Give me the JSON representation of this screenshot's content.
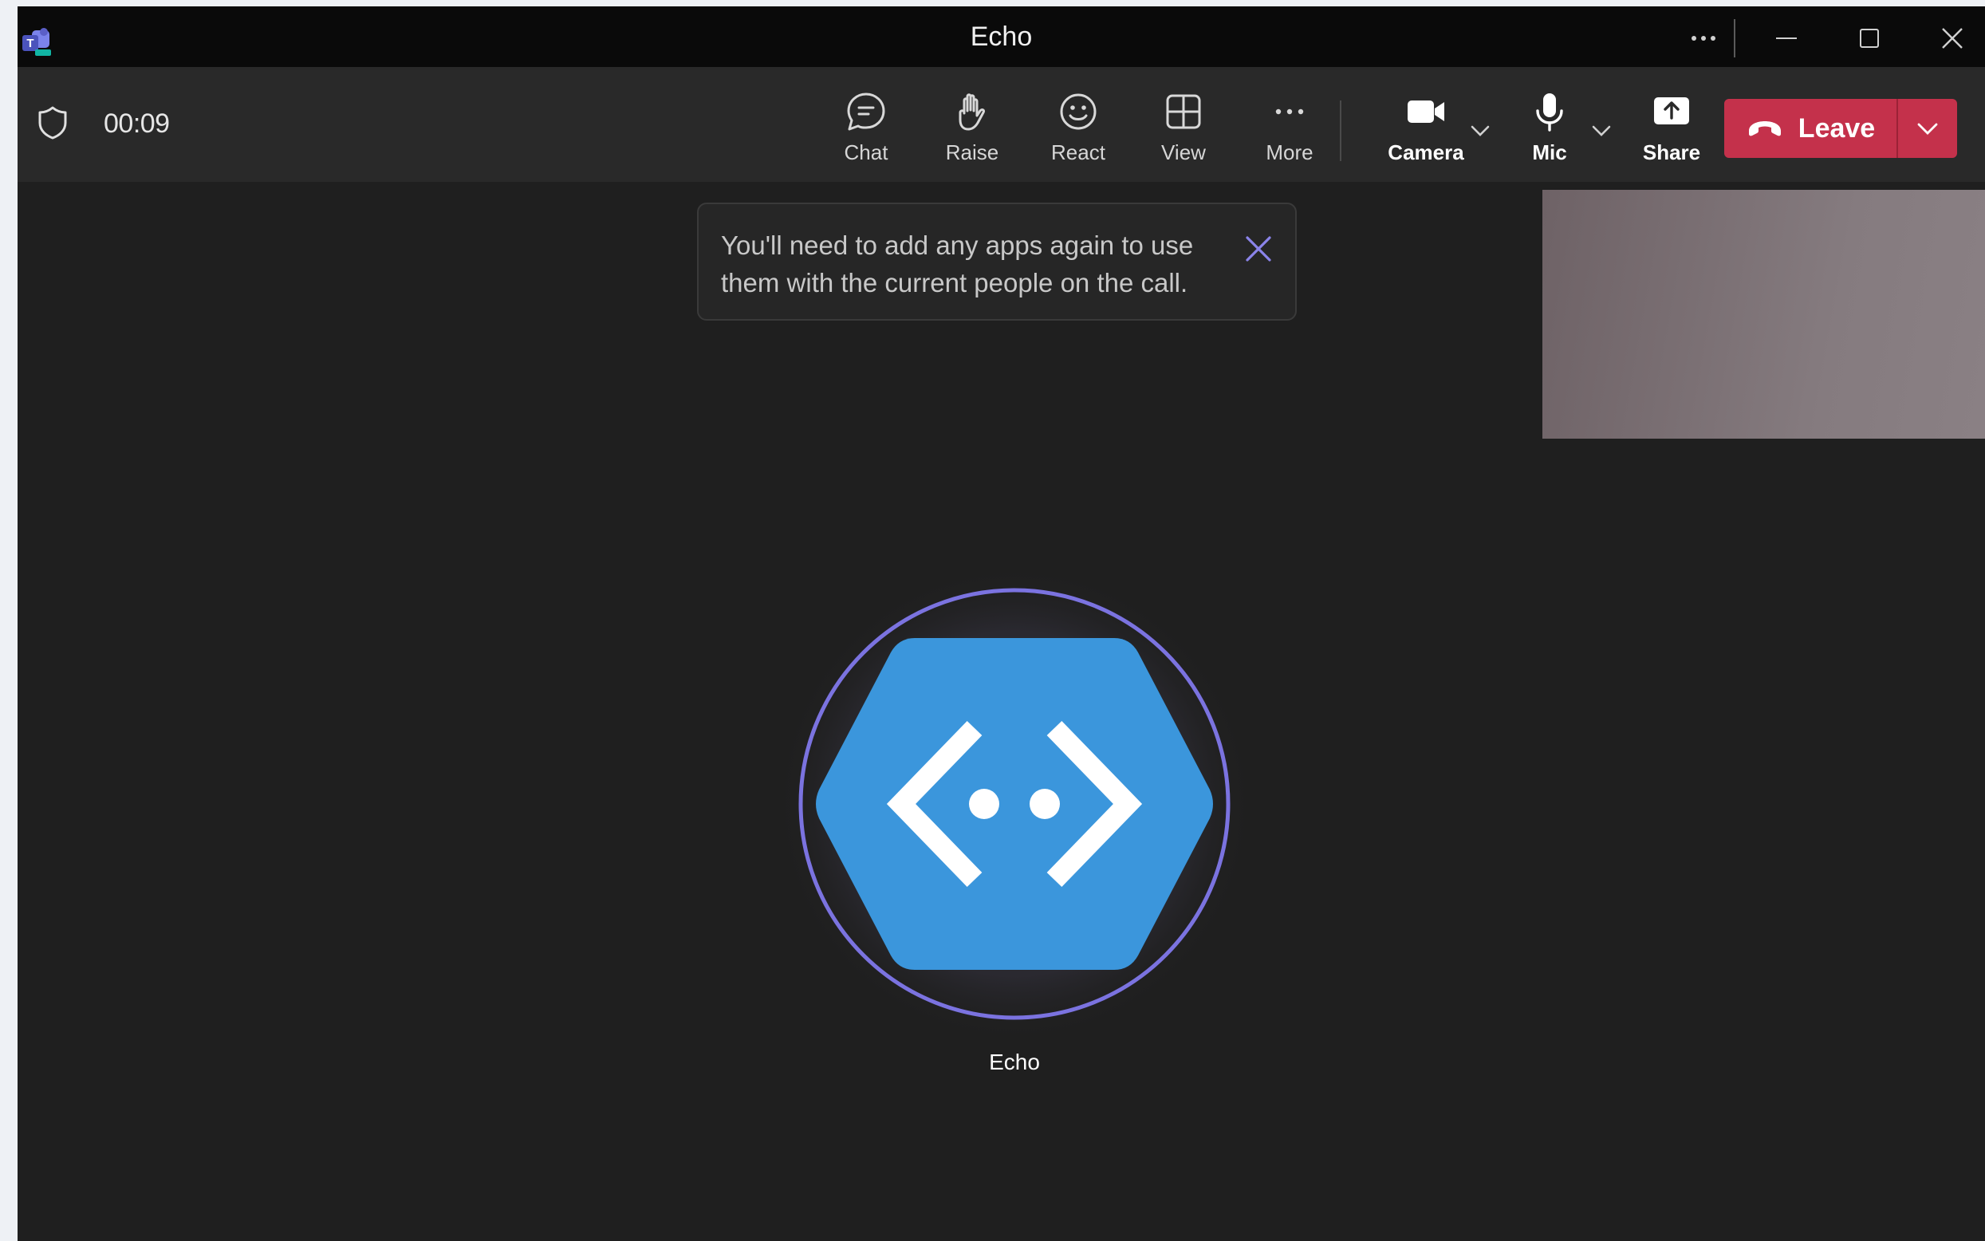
{
  "window": {
    "title": "Echo"
  },
  "titlebar": {
    "more_icon": "ellipsis-icon",
    "minimize_icon": "minimize-icon",
    "maximize_icon": "maximize-icon",
    "close_icon": "close-icon"
  },
  "toolbar": {
    "timer": "00:09",
    "items": [
      {
        "id": "chat",
        "label": "Chat",
        "icon": "chat-icon"
      },
      {
        "id": "raise",
        "label": "Raise",
        "icon": "hand-icon"
      },
      {
        "id": "react",
        "label": "React",
        "icon": "smiley-icon"
      },
      {
        "id": "view",
        "label": "View",
        "icon": "grid-icon"
      },
      {
        "id": "more",
        "label": "More",
        "icon": "ellipsis-icon"
      },
      {
        "id": "camera",
        "label": "Camera",
        "icon": "camera-icon"
      },
      {
        "id": "mic",
        "label": "Mic",
        "icon": "mic-icon"
      },
      {
        "id": "share",
        "label": "Share",
        "icon": "share-icon"
      }
    ],
    "leave_label": "Leave"
  },
  "notification": {
    "text": "You'll need to add any apps again to use them with the current people on the call."
  },
  "participant": {
    "name": "Echo",
    "icon": "echo-bot-icon"
  },
  "colors": {
    "leave": "#c4314b",
    "accent": "#7b73e0",
    "avatar": "#3b96dc"
  }
}
